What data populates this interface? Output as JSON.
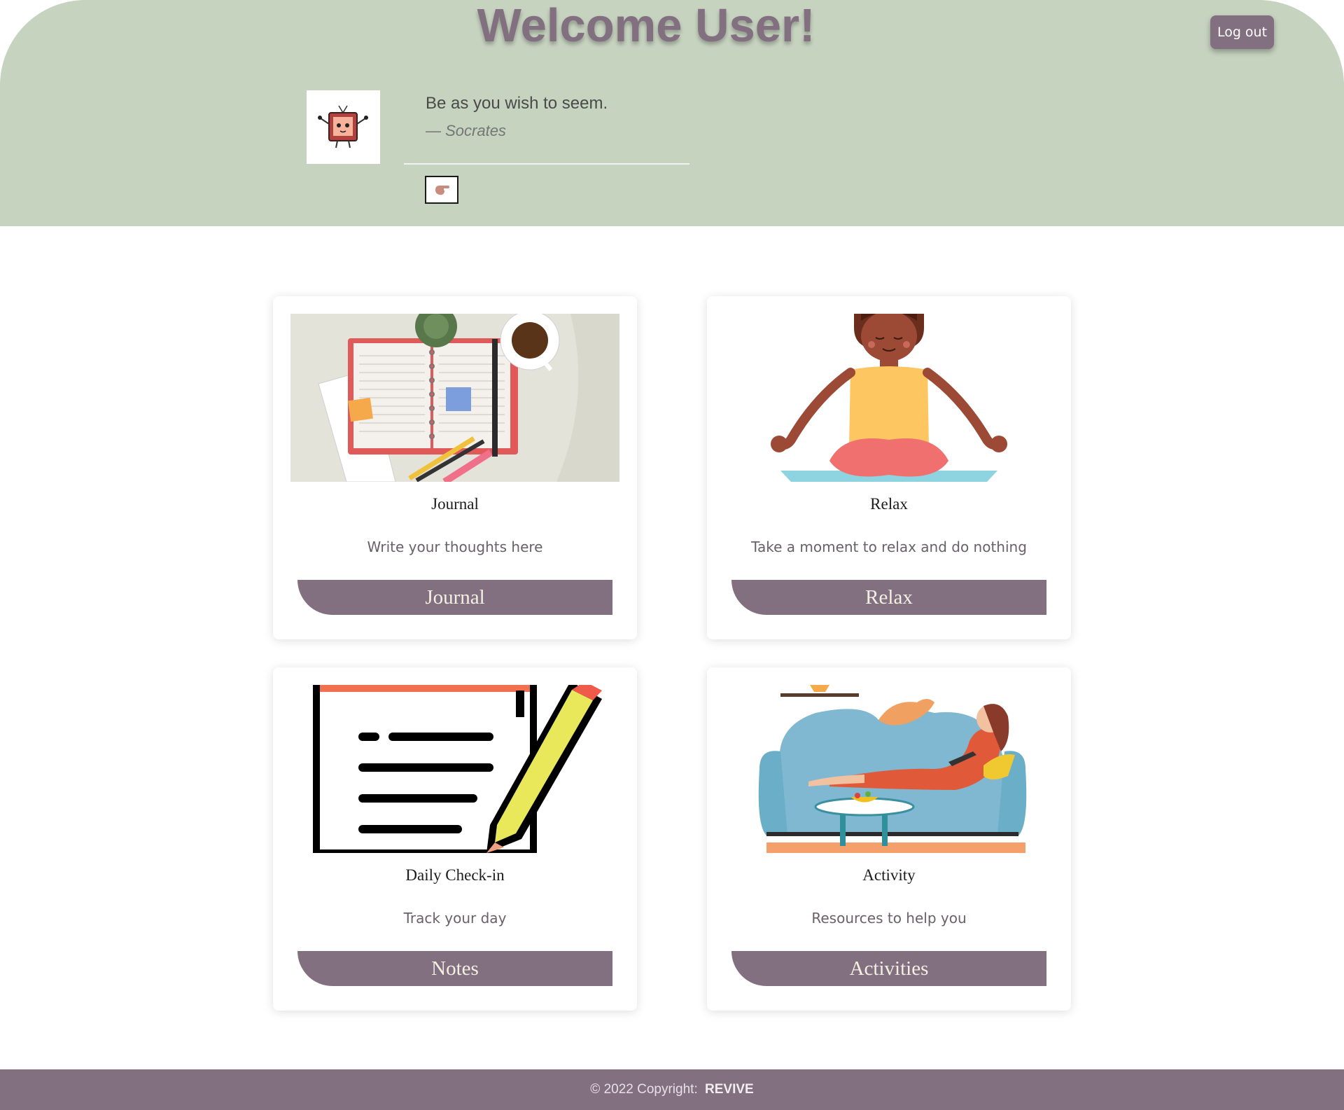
{
  "header": {
    "title": "Welcome User!",
    "logout_label": "Log out",
    "quote": "Be as you wish to seem.",
    "author": "— Socrates"
  },
  "cards": [
    {
      "title": "Journal",
      "text": "Write your thoughts here",
      "button": "Journal",
      "icon": "journal-illustration"
    },
    {
      "title": "Relax",
      "text": "Take a moment to relax and do nothing",
      "button": "Relax",
      "icon": "meditation-illustration"
    },
    {
      "title": "Daily Check-in",
      "text": "Track your day",
      "button": "Notes",
      "icon": "notes-pencil-illustration"
    },
    {
      "title": "Activity",
      "text": "Resources to help you",
      "button": "Activities",
      "icon": "couch-reading-illustration"
    }
  ],
  "footer": {
    "copyright": "© 2022 Copyright:",
    "brand": "REVIVE"
  },
  "colors": {
    "header_bg": "#c6d3bf",
    "accent": "#826f80",
    "button_text": "#f3f0e3"
  }
}
